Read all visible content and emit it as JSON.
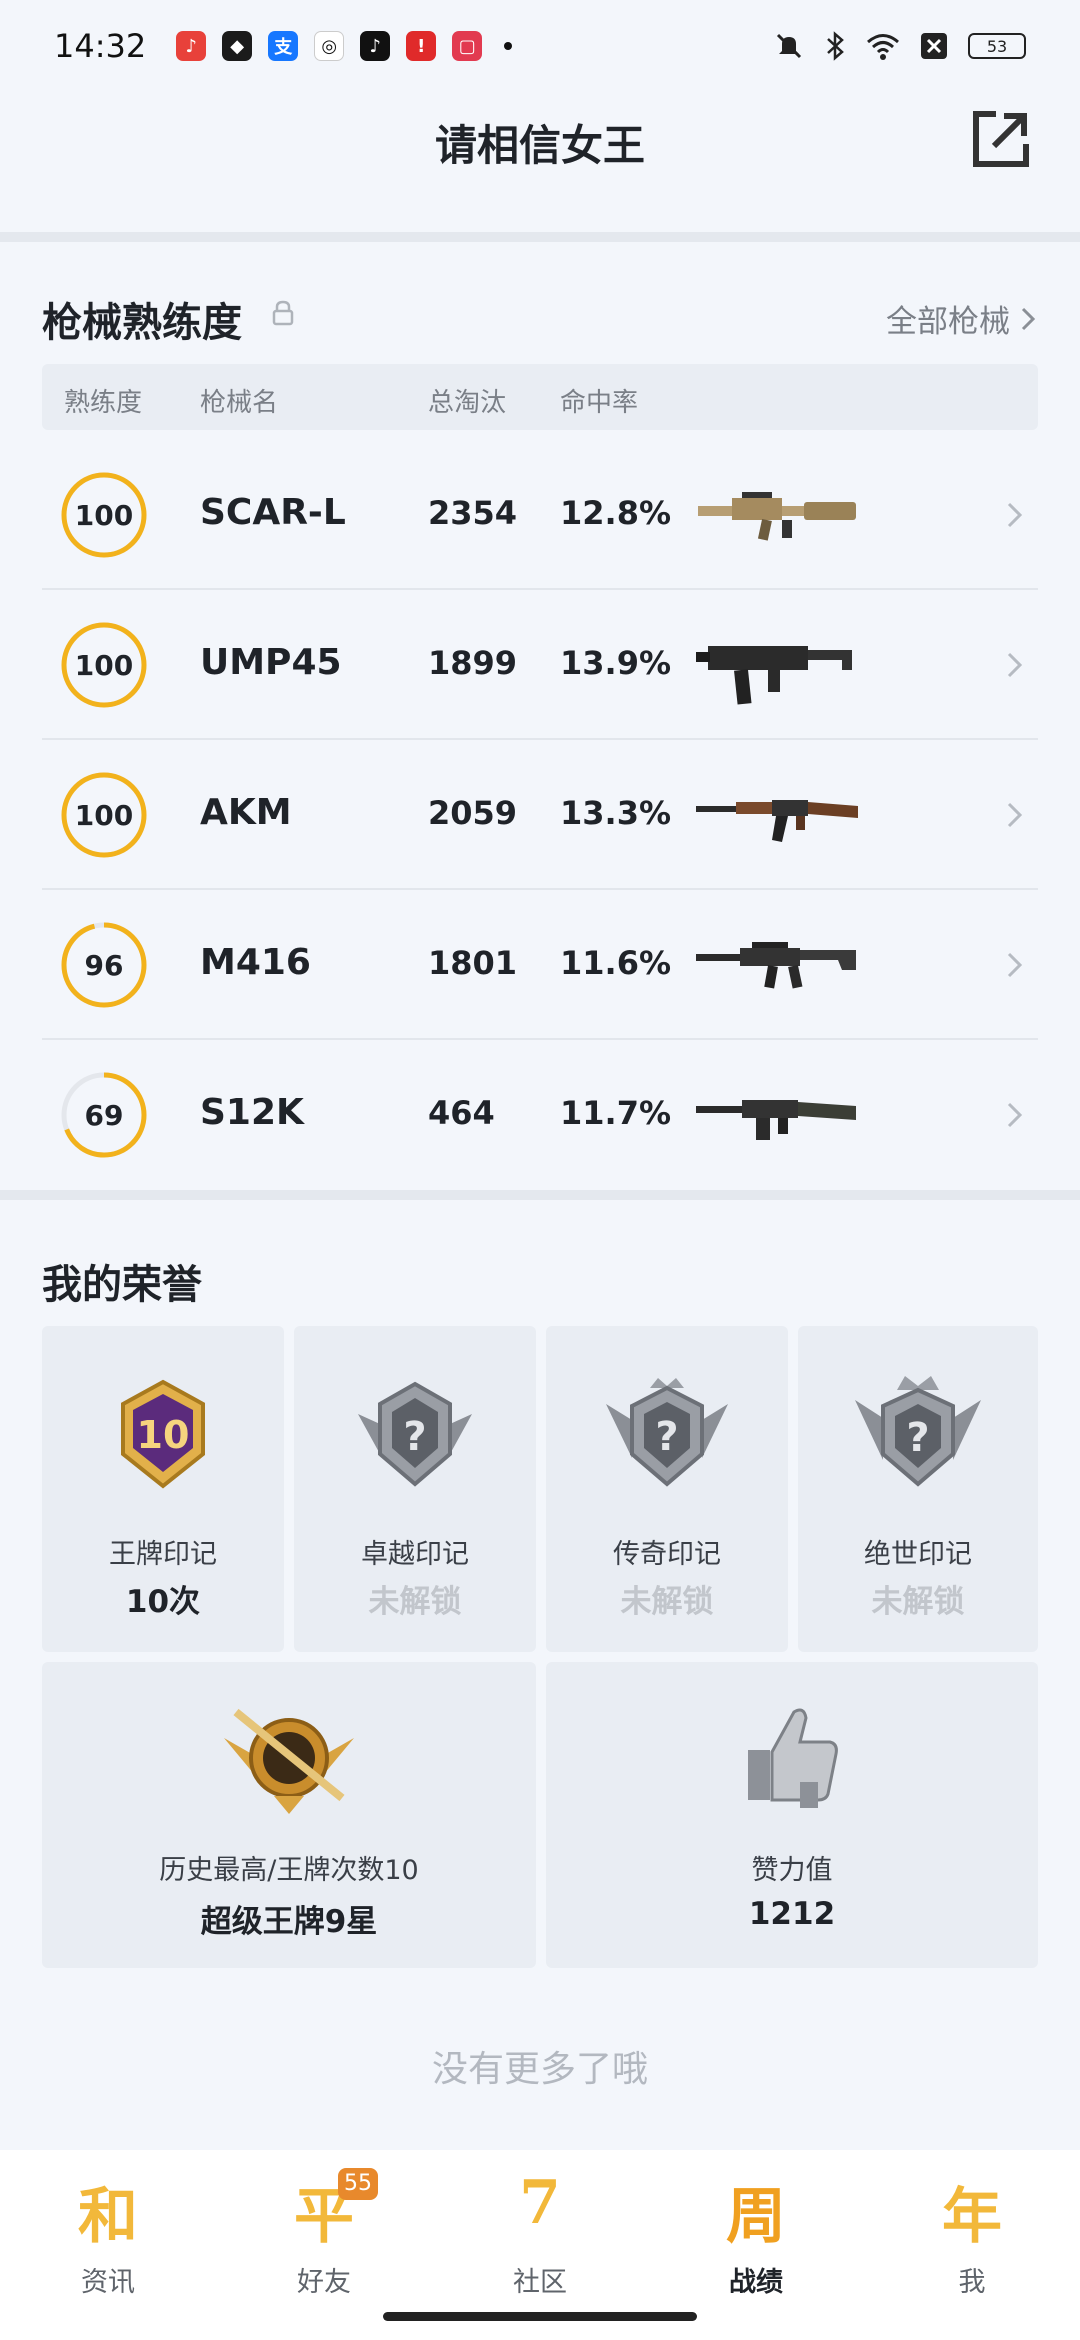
{
  "status_bar": {
    "time": "14:32",
    "battery": "53"
  },
  "header": {
    "title": "请相信女王"
  },
  "mastery": {
    "title": "枪械熟练度",
    "all_label": "全部枪械",
    "columns": [
      "熟练度",
      "枪械名",
      "总淘汰",
      "命中率"
    ],
    "rows": [
      {
        "level": "100",
        "level_value": 100,
        "name": "SCAR-L",
        "kills": "2354",
        "rate": "12.8%"
      },
      {
        "level": "100",
        "level_value": 100,
        "name": "UMP45",
        "kills": "1899",
        "rate": "13.9%"
      },
      {
        "level": "100",
        "level_value": 100,
        "name": "AKM",
        "kills": "2059",
        "rate": "13.3%"
      },
      {
        "level": "96",
        "level_value": 96,
        "name": "M416",
        "kills": "1801",
        "rate": "11.6%"
      },
      {
        "level": "69",
        "level_value": 69,
        "name": "S12K",
        "kills": "464",
        "rate": "11.7%"
      }
    ],
    "ring_color": "#f2b21c"
  },
  "honors": {
    "title": "我的荣誉",
    "items": [
      {
        "label": "王牌印记",
        "value": "10次",
        "badge_text": "10",
        "locked": false
      },
      {
        "label": "卓越印记",
        "value": "未解锁",
        "badge_text": "?",
        "locked": true
      },
      {
        "label": "传奇印记",
        "value": "未解锁",
        "badge_text": "?",
        "locked": true
      },
      {
        "label": "绝世印记",
        "value": "未解锁",
        "badge_text": "?",
        "locked": true
      }
    ],
    "wide": [
      {
        "label": "历史最高/王牌次数10",
        "value": "超级王牌9星"
      },
      {
        "label": "赞力值",
        "value": "1212"
      }
    ]
  },
  "footer": {
    "no_more": "没有更多了哦"
  },
  "bottom_nav": {
    "items": [
      {
        "glyph": "和",
        "label": "资讯",
        "badge": ""
      },
      {
        "glyph": "平",
        "label": "好友",
        "badge": "55"
      },
      {
        "glyph": "7",
        "label": "社区",
        "badge": ""
      },
      {
        "glyph": "周",
        "label": "战绩",
        "badge": ""
      },
      {
        "glyph": "年",
        "label": "我",
        "badge": ""
      }
    ],
    "active_index": 3
  }
}
